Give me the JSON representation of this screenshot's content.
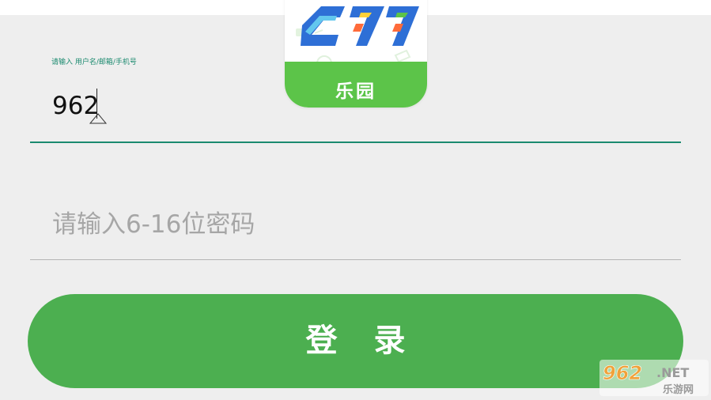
{
  "logo": {
    "icon": "app-logo-277",
    "caption": "乐园",
    "band_color": "#5cc449"
  },
  "login_form": {
    "username": {
      "floating_label": "请输入 用户名/邮箱/手机号",
      "value": "962"
    },
    "password": {
      "placeholder": "请输入6-16位密码"
    },
    "accent_color": "#1b8a6f"
  },
  "login_button": {
    "label": "登录",
    "color": "#4caf50"
  },
  "watermark": {
    "brand": "962",
    "suffix": ".NET",
    "site_name": "乐游网"
  }
}
